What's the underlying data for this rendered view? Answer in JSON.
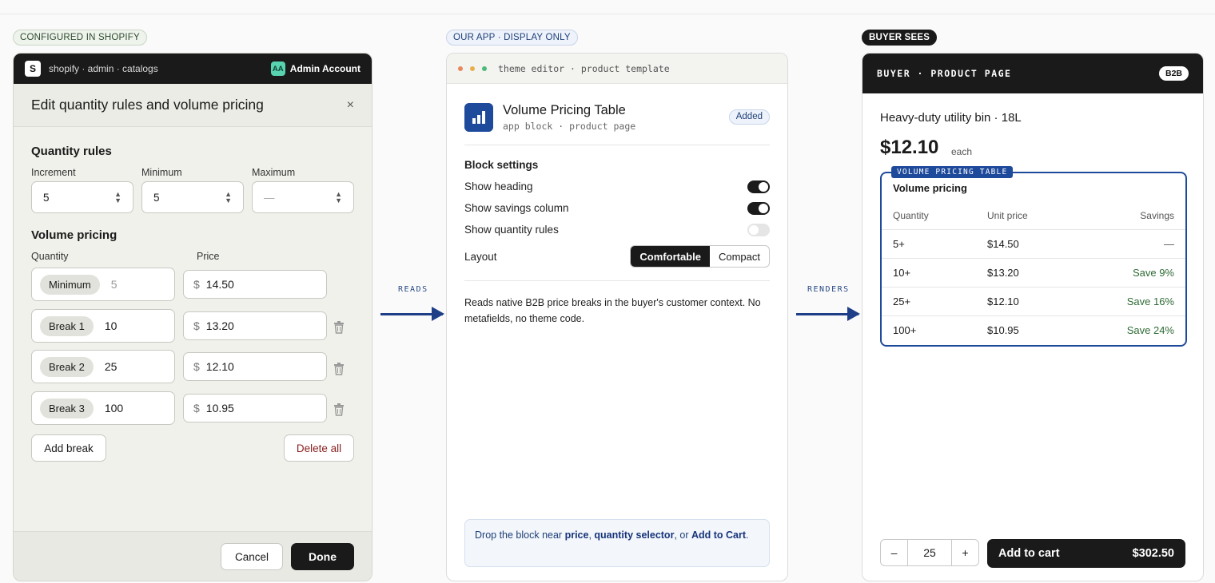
{
  "pills": {
    "configured": "CONFIGURED IN SHOPIFY",
    "app": "OUR APP · DISPLAY ONLY",
    "buyer": "BUYER SEES"
  },
  "admin": {
    "logo": "S",
    "breadcrumb": "shopify · admin · catalogs",
    "account_initials": "AA",
    "account_name": "Admin Account",
    "modal_title": "Edit quantity rules and volume pricing",
    "close": "×",
    "quantity_rules": {
      "title": "Quantity rules",
      "increment_label": "Increment",
      "increment_value": "5",
      "minimum_label": "Minimum",
      "minimum_value": "5",
      "maximum_label": "Maximum",
      "maximum_value": "—"
    },
    "volume_pricing": {
      "title": "Volume pricing",
      "quantity_label": "Quantity",
      "price_label": "Price",
      "currency": "$",
      "rows": [
        {
          "tag": "Minimum",
          "qty": "5",
          "price": "14.50"
        },
        {
          "tag": "Break 1",
          "qty": "10",
          "price": "13.20"
        },
        {
          "tag": "Break 2",
          "qty": "25",
          "price": "12.10"
        },
        {
          "tag": "Break 3",
          "qty": "100",
          "price": "10.95"
        }
      ]
    },
    "add_break": "Add break",
    "delete_all": "Delete all",
    "cancel": "Cancel",
    "done": "Done"
  },
  "arrows": {
    "reads": "READS",
    "renders": "RENDERS"
  },
  "theme": {
    "bar_title": "theme editor · product template",
    "block_name": "Volume Pricing Table",
    "block_sub": "app block · product page",
    "added": "Added",
    "settings_title": "Block settings",
    "show_heading": "Show heading",
    "show_savings": "Show savings column",
    "show_rules": "Show quantity rules",
    "layout_label": "Layout",
    "layout_opt1": "Comfortable",
    "layout_opt2": "Compact",
    "description": "Reads native B2B price breaks in the buyer's customer context. No metafields, no theme code.",
    "tip_pre": "Drop the block near ",
    "tip_b1": "price",
    "tip_sep1": ", ",
    "tip_b2": "quantity selector",
    "tip_sep2": ", or ",
    "tip_b3": "Add to Cart",
    "tip_end": "."
  },
  "buyer": {
    "bar_title": "BUYER · PRODUCT PAGE",
    "badge": "B2B",
    "product_title": "Heavy-duty utility bin · 18L",
    "price": "$12.10",
    "each": "each",
    "table_tag": "VOLUME PRICING TABLE",
    "table_heading": "Volume pricing",
    "col_qty": "Quantity",
    "col_price": "Unit price",
    "col_savings": "Savings",
    "rows": [
      {
        "qty": "5+",
        "price": "$14.50",
        "savings": "—"
      },
      {
        "qty": "10+",
        "price": "$13.20",
        "savings": "Save 9%"
      },
      {
        "qty": "25+",
        "price": "$12.10",
        "savings": "Save 16%"
      },
      {
        "qty": "100+",
        "price": "$10.95",
        "savings": "Save 24%"
      }
    ],
    "qty_minus": "–",
    "qty_value": "25",
    "qty_plus": "+",
    "add_to_cart": "Add to cart",
    "total": "$302.50"
  }
}
